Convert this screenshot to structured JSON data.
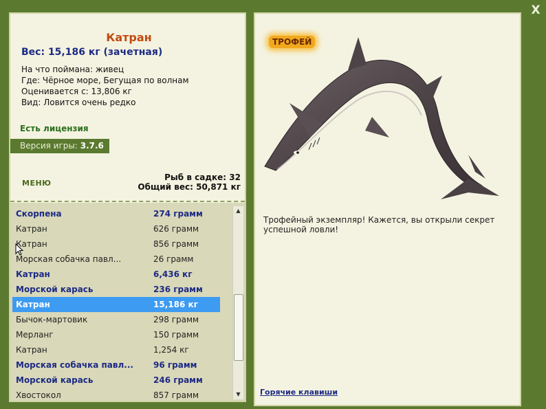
{
  "window": {
    "close_label": "X"
  },
  "fish": {
    "name": "Катран",
    "weight_line": "Вес: 15,186 кг (зачетная)",
    "bait_label": "На что поймана:",
    "bait": "живец",
    "place_label": "Где:",
    "place": "Чёрное море, Бегущая по волнам",
    "value_label": "Оценивается с:",
    "value": "13,806 кг",
    "type_label": "Вид:",
    "type": "Ловится очень редко"
  },
  "license": "Есть лицензия",
  "version": {
    "label": "Версия игры:",
    "value": "3.7.6"
  },
  "menu_label": "МЕНЮ",
  "cage": {
    "count_label": "Рыб в садке:",
    "count": "32",
    "total_label": "Общий вес:",
    "total": "50,871 кг"
  },
  "catch_list": [
    {
      "name": "Скорпена",
      "weight": "274 грамм",
      "style": "bold"
    },
    {
      "name": "Катран",
      "weight": "626 грамм",
      "style": "normal"
    },
    {
      "name": "Катран",
      "weight": "856 грамм",
      "style": "normal"
    },
    {
      "name": "Морская собачка павл...",
      "weight": "26 грамм",
      "style": "normal"
    },
    {
      "name": "Катран",
      "weight": "6,436 кг",
      "style": "bold"
    },
    {
      "name": "Морской карась",
      "weight": "236 грамм",
      "style": "bold"
    },
    {
      "name": "Катран",
      "weight": "15,186 кг",
      "style": "selected"
    },
    {
      "name": "Бычок-мартовик",
      "weight": "298 грамм",
      "style": "normal"
    },
    {
      "name": "Мерланг",
      "weight": "150 грамм",
      "style": "normal"
    },
    {
      "name": "Катран",
      "weight": "1,254 кг",
      "style": "normal"
    },
    {
      "name": "Морская собачка павл...",
      "weight": "96 грамм",
      "style": "bold"
    },
    {
      "name": "Морской карась",
      "weight": "246 грамм",
      "style": "bold"
    },
    {
      "name": "Хвостокол",
      "weight": "857 грамм",
      "style": "normal"
    }
  ],
  "trophy_badge": "ТРОФЕЙ",
  "description": "Трофейный экземпляр! Кажется, вы открыли секрет успешной ловли!",
  "hotkeys_link": "Горячие клавиши",
  "colors": {
    "background": "#5b7a2f",
    "panel": "#f4f3e1",
    "fish_name": "#c04a10",
    "accent_blue": "#1c2a84",
    "selection": "#3d9bf2",
    "license_green": "#2b6f1c"
  }
}
